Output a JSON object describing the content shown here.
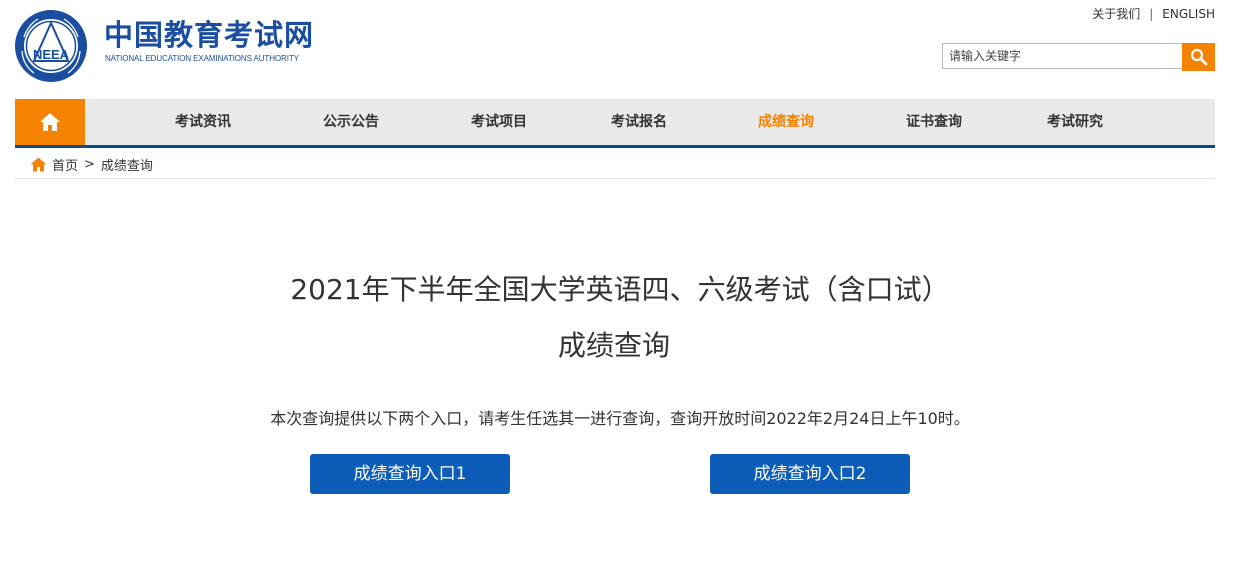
{
  "header": {
    "logo_cn": "中国教育考试网",
    "logo_en": "NATIONAL EDUCATION EXAMINATIONS AUTHORITY",
    "emblem_text": "NEEA",
    "top_links": {
      "about": "关于我们",
      "separator": "|",
      "english": "ENGLISH"
    },
    "search": {
      "placeholder": "请输入关键字",
      "icon": "search-icon"
    }
  },
  "nav": {
    "home_icon": "home-icon",
    "items": [
      {
        "label": "考试资讯"
      },
      {
        "label": "公示公告"
      },
      {
        "label": "考试项目"
      },
      {
        "label": "考试报名"
      },
      {
        "label": "成绩查询",
        "active": true
      },
      {
        "label": "证书查询"
      },
      {
        "label": "考试研究"
      }
    ]
  },
  "breadcrumb": {
    "icon": "home-icon",
    "home": "首页",
    "separator": ">",
    "current": "成绩查询"
  },
  "main": {
    "title_line1": "2021年下半年全国大学英语四、六级考试（含口试）",
    "title_line2": "成绩查询",
    "notice": "本次查询提供以下两个入口，请考生任选其一进行查询，查询开放时间2022年2月24日上午10时。",
    "entry1": "成绩查询入口1",
    "entry2": "成绩查询入口2"
  },
  "colors": {
    "brand_blue": "#1a4ea0",
    "accent_orange": "#f58200",
    "button_blue": "#0c5cb8",
    "nav_bg": "#e9e9e9"
  }
}
